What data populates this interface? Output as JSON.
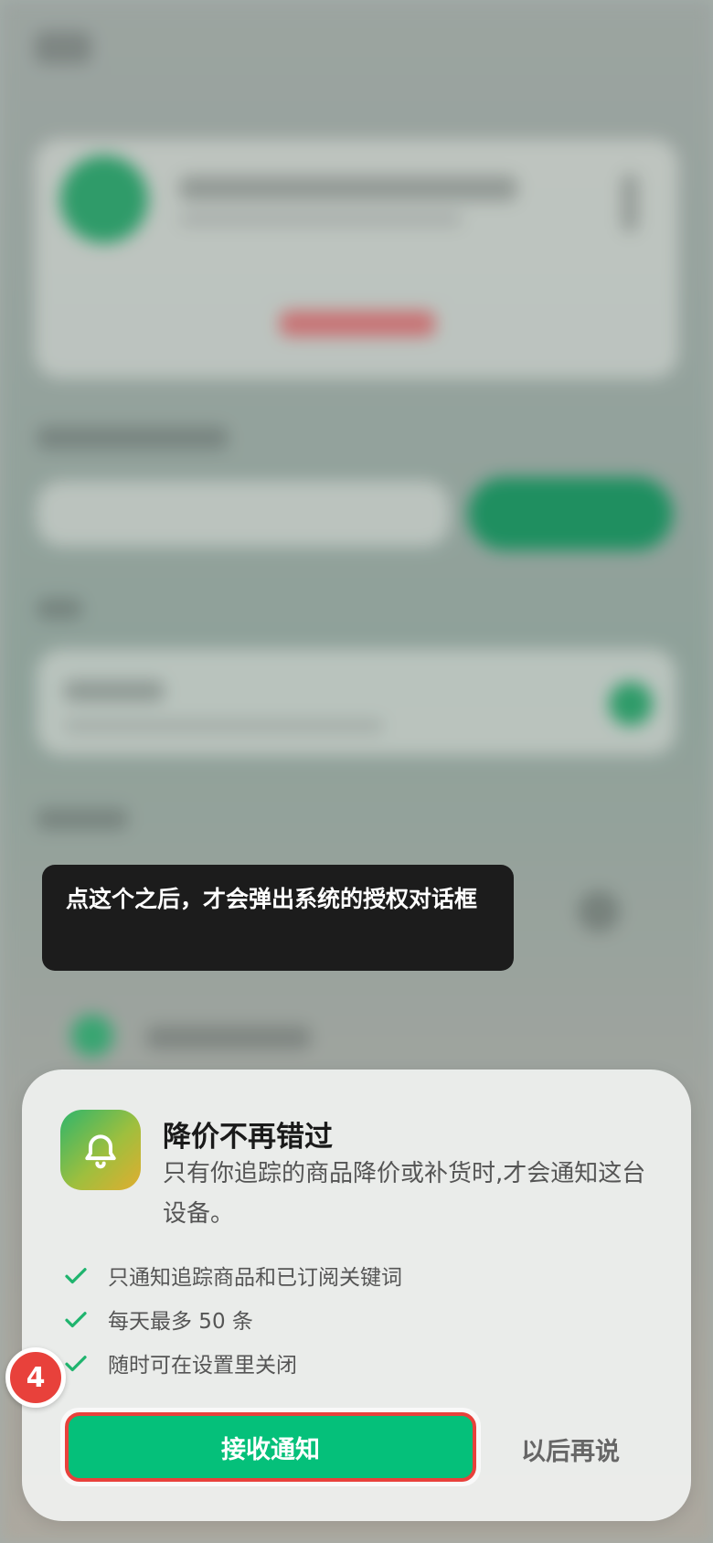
{
  "tooltip": {
    "text": "点这个之后，才会弹出系统的授权对话框"
  },
  "sheet": {
    "icon": "bell-icon",
    "title": "降价不再错过",
    "description": "只有你追踪的商品降价或补货时,才会通知这台设备。",
    "bullets": [
      "只通知追踪商品和已订阅关键词",
      "每天最多 50 条",
      "随时可在设置里关闭"
    ],
    "accept_label": "接收通知",
    "later_label": "以后再说"
  },
  "step_badge": "4",
  "colors": {
    "accent_green": "#05c07a",
    "highlight_red": "#e8413b",
    "check_green": "#1fb46e"
  }
}
